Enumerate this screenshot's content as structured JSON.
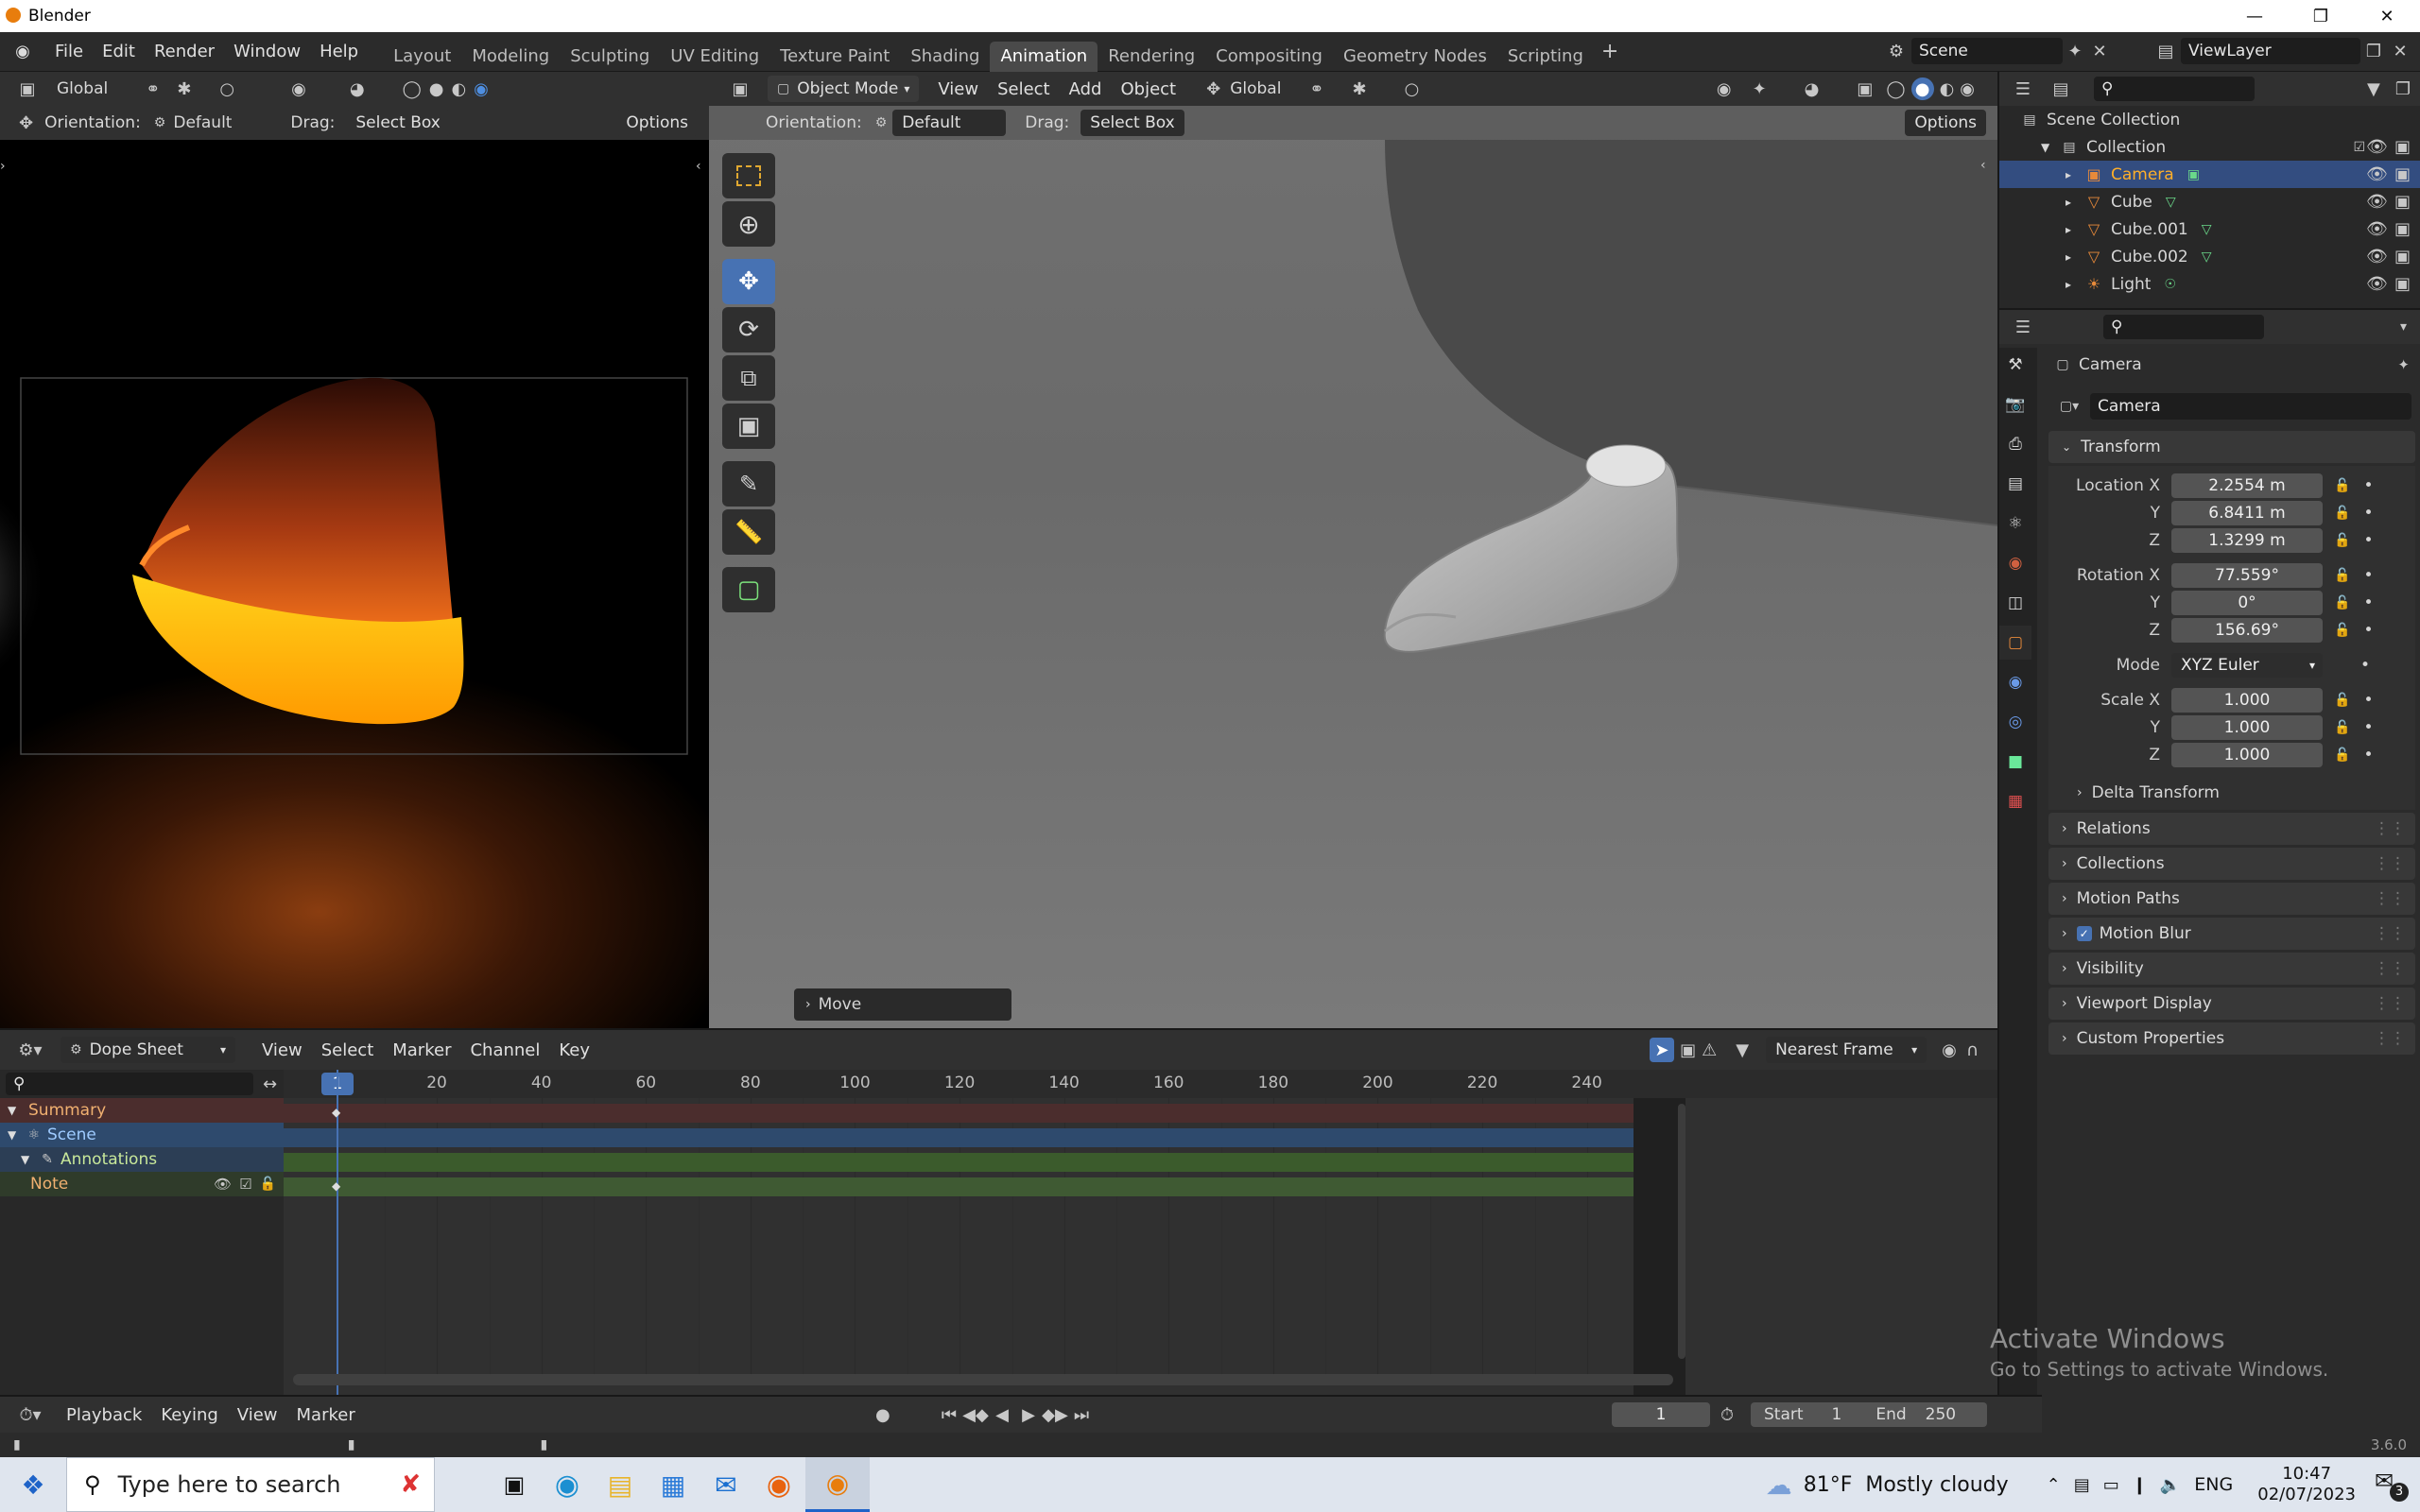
{
  "window": {
    "title": "Blender"
  },
  "menu": [
    "File",
    "Edit",
    "Render",
    "Window",
    "Help"
  ],
  "workspaces": [
    {
      "label": "Layout"
    },
    {
      "label": "Modeling"
    },
    {
      "label": "Sculpting"
    },
    {
      "label": "UV Editing"
    },
    {
      "label": "Texture Paint"
    },
    {
      "label": "Shading"
    },
    {
      "label": "Animation",
      "active": true
    },
    {
      "label": "Rendering"
    },
    {
      "label": "Compositing"
    },
    {
      "label": "Geometry Nodes"
    },
    {
      "label": "Scripting"
    }
  ],
  "scene": "Scene",
  "view_layer": "ViewLayer",
  "left_header": {
    "transform": "Global",
    "orientation_label": "Orientation:",
    "orientation": "Default",
    "drag_label": "Drag:",
    "drag": "Select Box",
    "options": "Options"
  },
  "viewport_header": {
    "mode": "Object Mode",
    "menus": [
      "View",
      "Select",
      "Add",
      "Object"
    ],
    "transform": "Global",
    "orientation_label": "Orientation:",
    "orientation": "Default",
    "drag_label": "Drag:",
    "drag": "Select Box",
    "options": "Options"
  },
  "operator_panel": "Move",
  "outliner": {
    "root": "Scene Collection",
    "collection": "Collection",
    "items": [
      {
        "label": "Camera",
        "selected": true,
        "icon": "camera-icon"
      },
      {
        "label": "Cube",
        "icon": "mesh-icon"
      },
      {
        "label": "Cube.001",
        "icon": "mesh-icon"
      },
      {
        "label": "Cube.002",
        "icon": "mesh-icon"
      },
      {
        "label": "Light",
        "icon": "light-icon"
      }
    ]
  },
  "properties": {
    "object_name": "Camera",
    "datablock": "Camera",
    "transform_label": "Transform",
    "location": {
      "label": "Location X",
      "x": "2.2554 m",
      "y": "6.8411 m",
      "z": "1.3299 m"
    },
    "rotation": {
      "label": "Rotation X",
      "x": "77.559°",
      "y": "0°",
      "z": "156.69°"
    },
    "mode_label": "Mode",
    "mode": "XYZ Euler",
    "scale": {
      "label": "Scale X",
      "x": "1.000",
      "y": "1.000",
      "z": "1.000"
    },
    "axis_y": "Y",
    "axis_z": "Z",
    "delta": "Delta Transform",
    "panels": [
      "Relations",
      "Collections",
      "Motion Paths",
      "Motion Blur",
      "Visibility",
      "Viewport Display",
      "Custom Properties"
    ]
  },
  "dopesheet": {
    "mode": "Dope Sheet",
    "menus": [
      "View",
      "Select",
      "Marker",
      "Channel",
      "Key"
    ],
    "snap": "Nearest Frame",
    "current_frame": "1",
    "ticks": [
      "20",
      "40",
      "60",
      "80",
      "100",
      "120",
      "140",
      "160",
      "180",
      "200",
      "220",
      "240"
    ],
    "channels": [
      {
        "label": "Summary",
        "type": "summary"
      },
      {
        "label": "Scene",
        "type": "scene"
      },
      {
        "label": "Annotations",
        "type": "object"
      },
      {
        "label": "Note",
        "type": "layer"
      }
    ]
  },
  "timeline": {
    "menus": [
      "Playback",
      "Keying",
      "View",
      "Marker"
    ],
    "frame": "1",
    "start_label": "Start",
    "start": "1",
    "end_label": "End",
    "end": "250"
  },
  "status": {
    "version": "3.6.0"
  },
  "watermark": {
    "line1": "Activate Windows",
    "line2": "Go to Settings to activate Windows."
  },
  "taskbar": {
    "search_placeholder": "Type here to search",
    "weather": "81°F  Mostly cloudy",
    "lang": "ENG",
    "time": "10:47",
    "date": "02/07/2023",
    "notifications": "3"
  }
}
